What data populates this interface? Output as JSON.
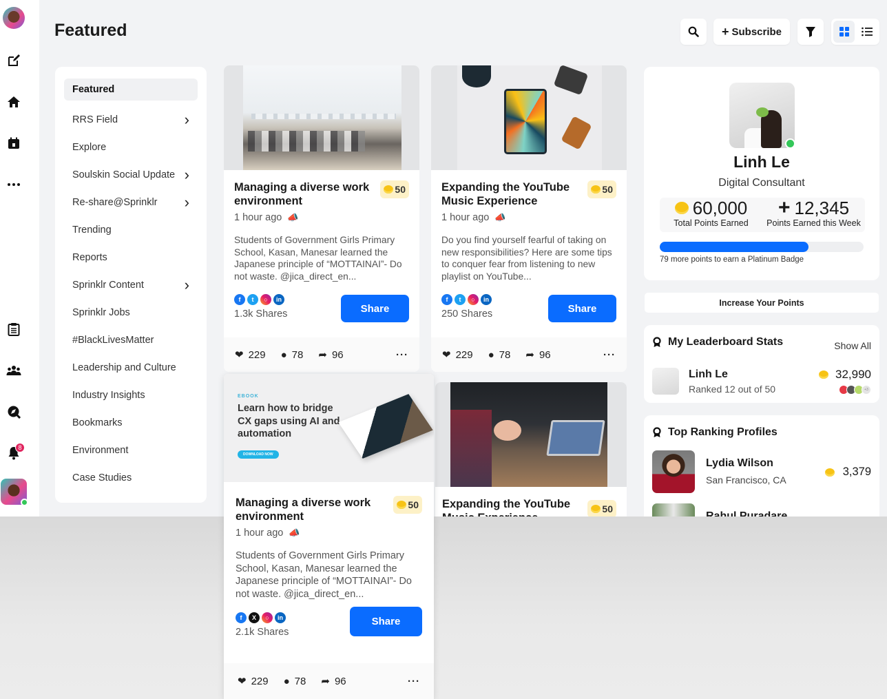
{
  "page": {
    "title": "Featured"
  },
  "rail": {
    "icons": [
      "avatar",
      "compose-icon",
      "home-icon",
      "calendar-icon",
      "more-icon",
      "clipboard-icon",
      "people-icon",
      "explore-icon",
      "bell-icon",
      "avatar"
    ],
    "notification_count": "8"
  },
  "toolbar": {
    "subscribe_label": "Subscribe",
    "view_modes": [
      "grid",
      "list"
    ],
    "active_view": "grid"
  },
  "nav": {
    "items": [
      {
        "label": "Featured",
        "active": true,
        "has_children": false
      },
      {
        "label": "RRS Field",
        "has_children": true
      },
      {
        "label": "Explore",
        "has_children": false
      },
      {
        "label": "Soulskin Social Update",
        "has_children": true
      },
      {
        "label": "Re-share@Sprinklr",
        "has_children": true
      },
      {
        "label": "Trending",
        "has_children": false
      },
      {
        "label": "Reports",
        "has_children": false
      },
      {
        "label": "Sprinklr Content",
        "has_children": true
      },
      {
        "label": "Sprinklr Jobs",
        "has_children": false
      },
      {
        "label": "#BlackLivesMatter",
        "has_children": false
      },
      {
        "label": "Leadership and Culture",
        "has_children": false
      },
      {
        "label": "Industry Insights",
        "has_children": false
      },
      {
        "label": "Bookmarks",
        "has_children": false
      },
      {
        "label": "Environment",
        "has_children": false
      },
      {
        "label": "Case Studies",
        "has_children": false
      }
    ]
  },
  "cards": [
    {
      "title": "Managing a diverse work environment",
      "points": "50",
      "time": "1 hour ago",
      "description": "Students of Government Girls Primary School, Kasan, Manesar learned the Japanese principle of “MOTTAINAI”- Do not waste. @jica_direct_en...",
      "shares": "1.3k Shares",
      "share_label": "Share",
      "likes": "229",
      "comments": "78",
      "reshares": "96"
    },
    {
      "title": "Expanding the YouTube Music Experience",
      "points": "50",
      "time": "1 hour ago",
      "description": "Do you find yourself fearful of taking on new responsibilities? Here are some tips to conquer fear from listening to new playlist on YouTube...",
      "shares": "250 Shares",
      "share_label": "Share",
      "likes": "229",
      "comments": "78",
      "reshares": "96"
    },
    {
      "ad": {
        "eyebrow": "EBOOK",
        "headline": "Learn how to bridge CX gaps using AI and automation",
        "cta": "DOWNLOAD NOW"
      },
      "title": "Managing a diverse work environment",
      "points": "50",
      "time": "1 hour ago",
      "description": "Students of Government Girls Primary School, Kasan, Manesar learned the Japanese principle of “MOTTAINAI”- Do not waste. @jica_direct_en...",
      "shares": "2.1k Shares",
      "share_label": "Share",
      "likes": "229",
      "comments": "78",
      "reshares": "96"
    },
    {
      "title": "Expanding the YouTube Music Experience",
      "points": "50"
    }
  ],
  "profile": {
    "name": "Linh Le",
    "role": "Digital Consultant",
    "total_points": "60,000",
    "total_points_label": "Total Points Earned",
    "week_points": "12,345",
    "week_points_label": "Points Earned this Week",
    "progress_percent": 73,
    "progress_label": "79 more points to earn a Platinum Badge",
    "online": true
  },
  "increase_points_label": "Increase Your Points",
  "leaderboard": {
    "title": "My Leaderboard Stats",
    "show_all": "Show All",
    "name": "Linh Le",
    "rank": "Ranked 12 out of 50",
    "points": "32,990",
    "extra_badges": "+3"
  },
  "top_profiles": {
    "title": "Top Ranking Profiles",
    "items": [
      {
        "name": "Lydia Wilson",
        "location": "San Francisco, CA",
        "points": "3,379"
      },
      {
        "name": "Rahul Puradare",
        "location": "",
        "points": ""
      }
    ]
  },
  "colors": {
    "accent": "#0a6cff",
    "points_bg": "#fdf1c7",
    "online": "#34c759",
    "notification": "#e0245e"
  }
}
